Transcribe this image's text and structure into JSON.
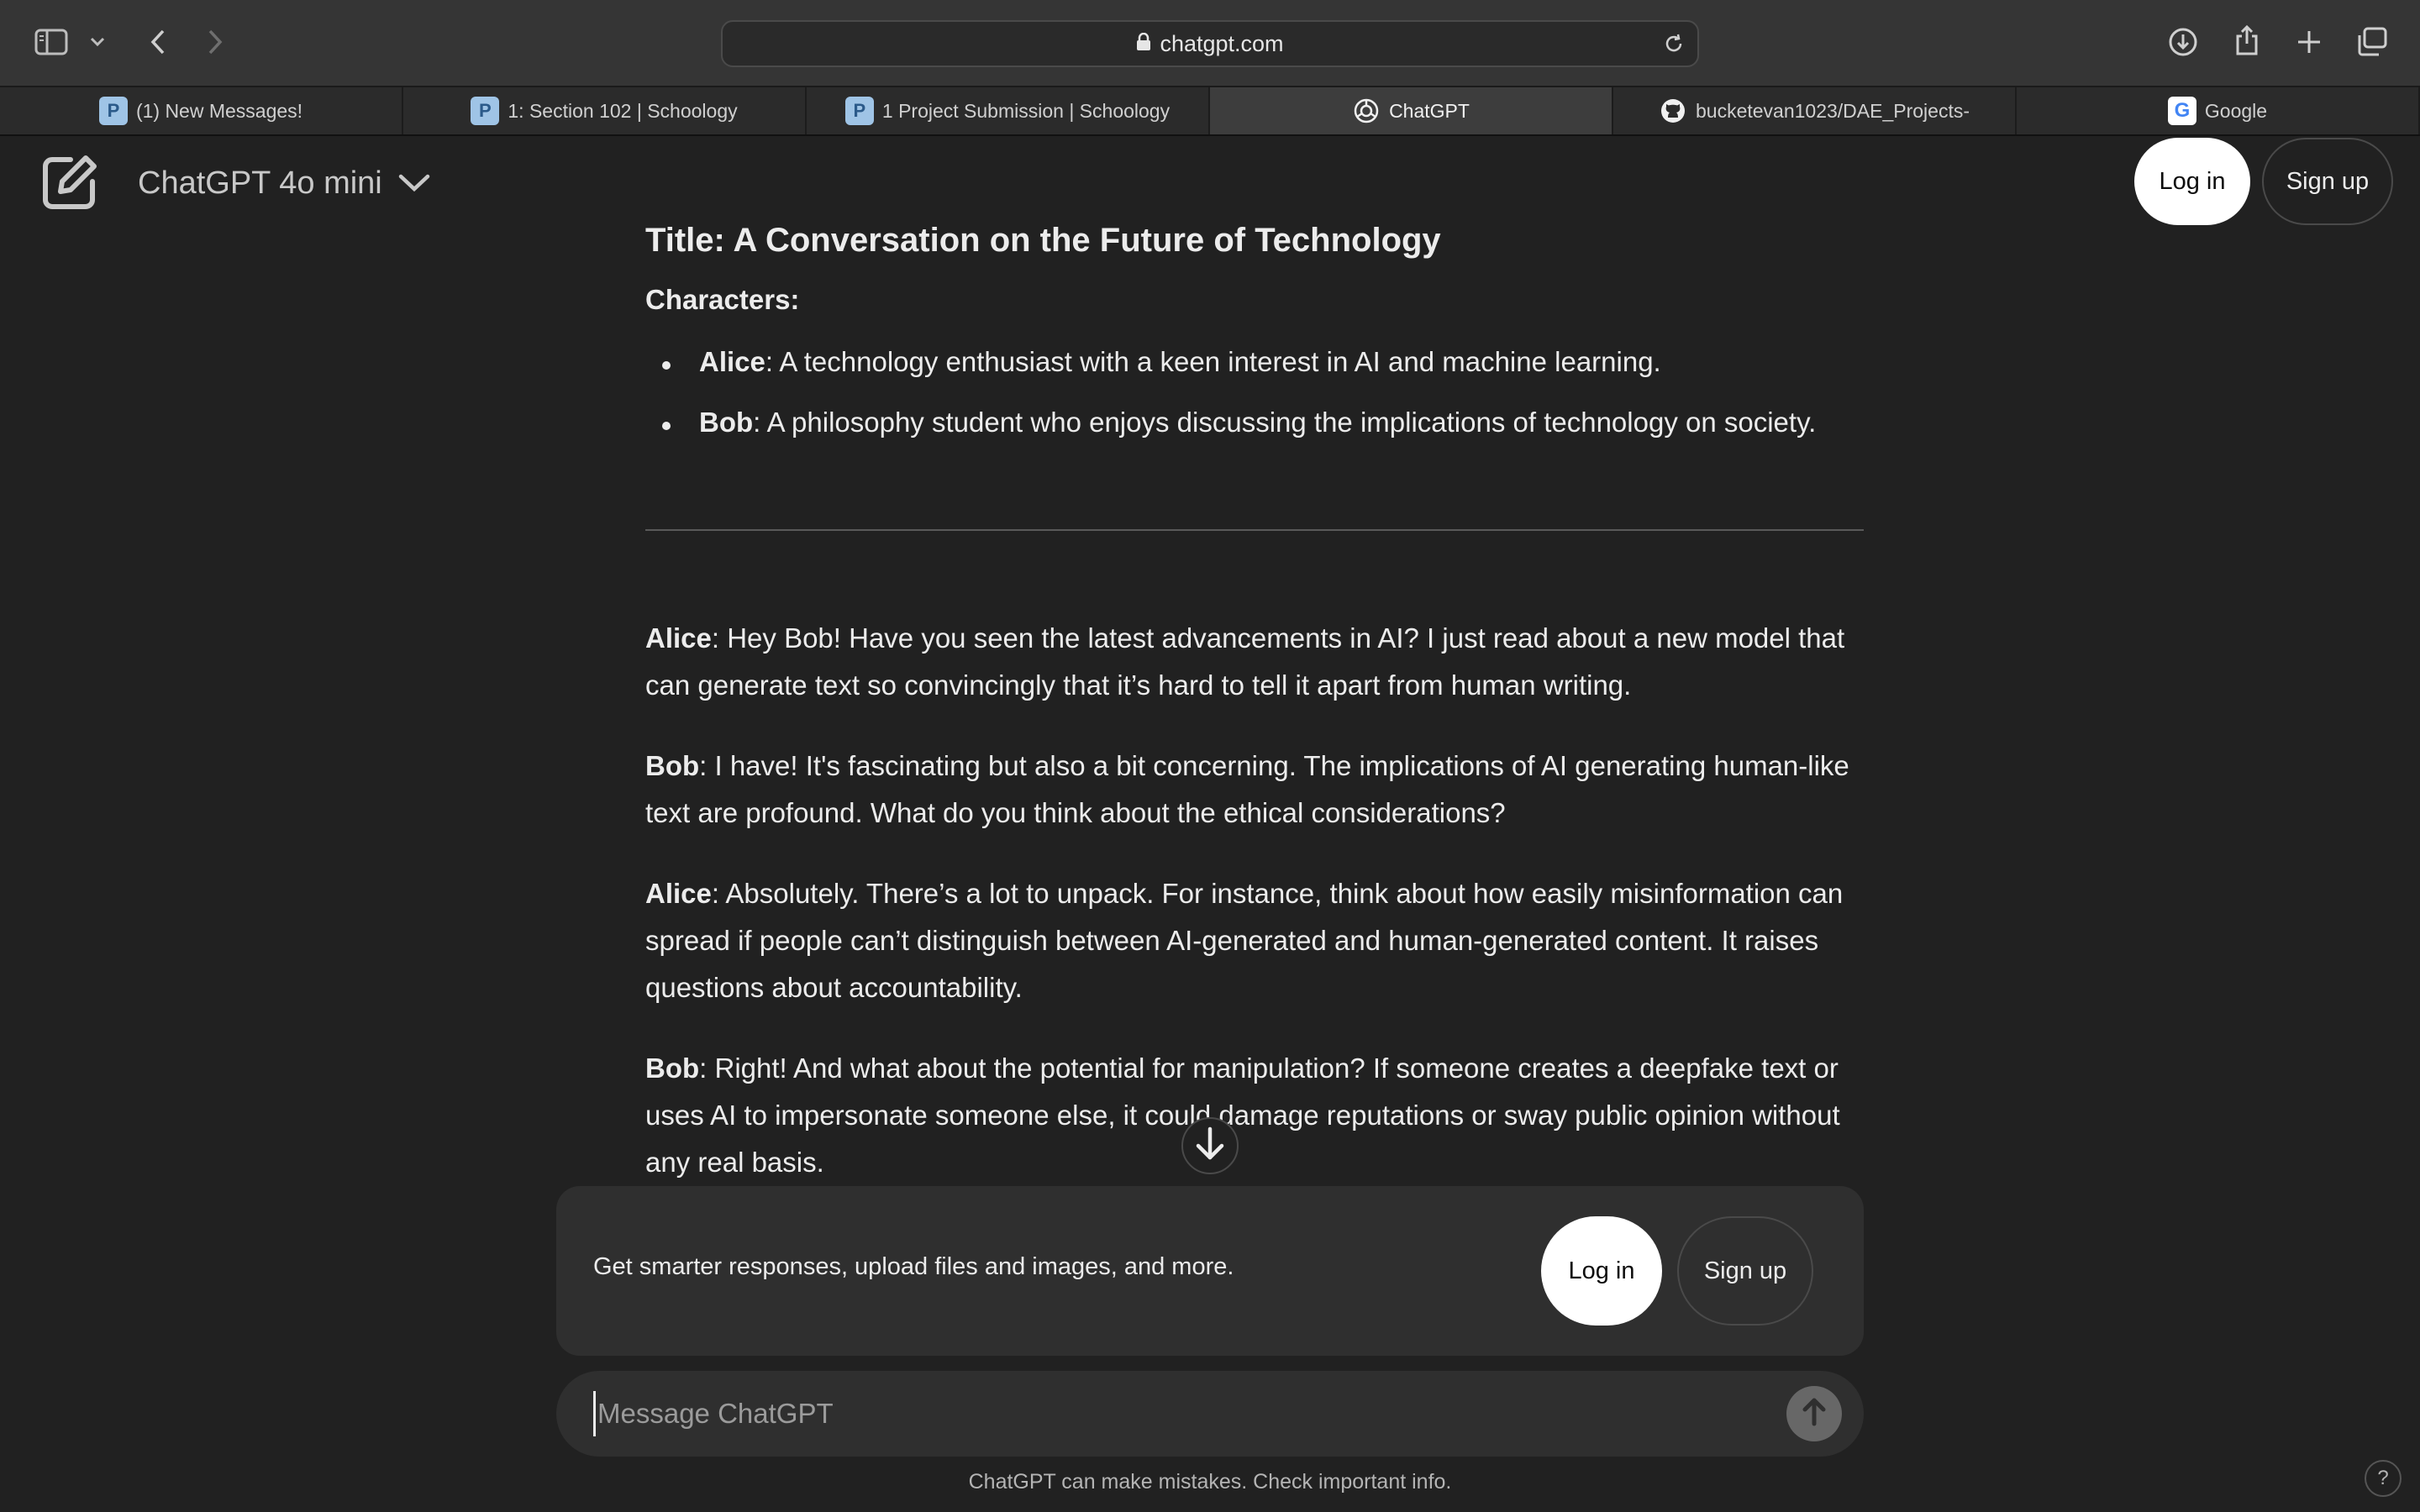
{
  "browser": {
    "url": "chatgpt.com",
    "tabs": [
      {
        "title": "(1) New Messages!",
        "icon": "schoology-icon"
      },
      {
        "title": "1: Section 102 | Schoology",
        "icon": "schoology-icon"
      },
      {
        "title": "1 Project Submission | Schoology",
        "icon": "schoology-icon"
      },
      {
        "title": "ChatGPT",
        "icon": "chatgpt-icon",
        "active": true
      },
      {
        "title": "bucketevan1023/DAE_Projects-",
        "icon": "github-icon"
      },
      {
        "title": "Google",
        "icon": "google-icon"
      }
    ]
  },
  "header": {
    "model": "ChatGPT 4o mini",
    "login": "Log in",
    "signup": "Sign up"
  },
  "conversation": {
    "title": "Title: A Conversation on the Future of Technology",
    "characters_label": "Characters:",
    "characters": [
      {
        "name": "Alice",
        "desc": ": A technology enthusiast with a keen interest in AI and machine learning."
      },
      {
        "name": "Bob",
        "desc": ": A philosophy student who enjoys discussing the implications of technology on society."
      }
    ],
    "lines": [
      {
        "speaker": "Alice",
        "text": ": Hey Bob! Have you seen the latest advancements in AI? I just read about a new model that can generate text so convincingly that it’s hard to tell it apart from human writing."
      },
      {
        "speaker": "Bob",
        "text": ": I have! It's fascinating but also a bit concerning. The implications of AI generating human-like text are profound. What do you think about the ethical considerations?"
      },
      {
        "speaker": "Alice",
        "text": ": Absolutely. There’s a lot to unpack. For instance, think about how easily misinformation can spread if people can’t distinguish between AI-generated and human-generated content. It raises questions about accountability."
      },
      {
        "speaker": "Bob",
        "text": ": Right! And what about the potential for manipulation? If someone creates a deepfake text or uses AI to impersonate someone else, it could damage reputations or sway public opinion without any real basis."
      }
    ]
  },
  "promo": {
    "text": "Get smarter responses, upload files and images, and more.",
    "login": "Log in",
    "signup": "Sign up"
  },
  "composer": {
    "placeholder": "Message ChatGPT"
  },
  "footer": {
    "disclaimer": "ChatGPT can make mistakes. Check important info.",
    "help": "?"
  }
}
